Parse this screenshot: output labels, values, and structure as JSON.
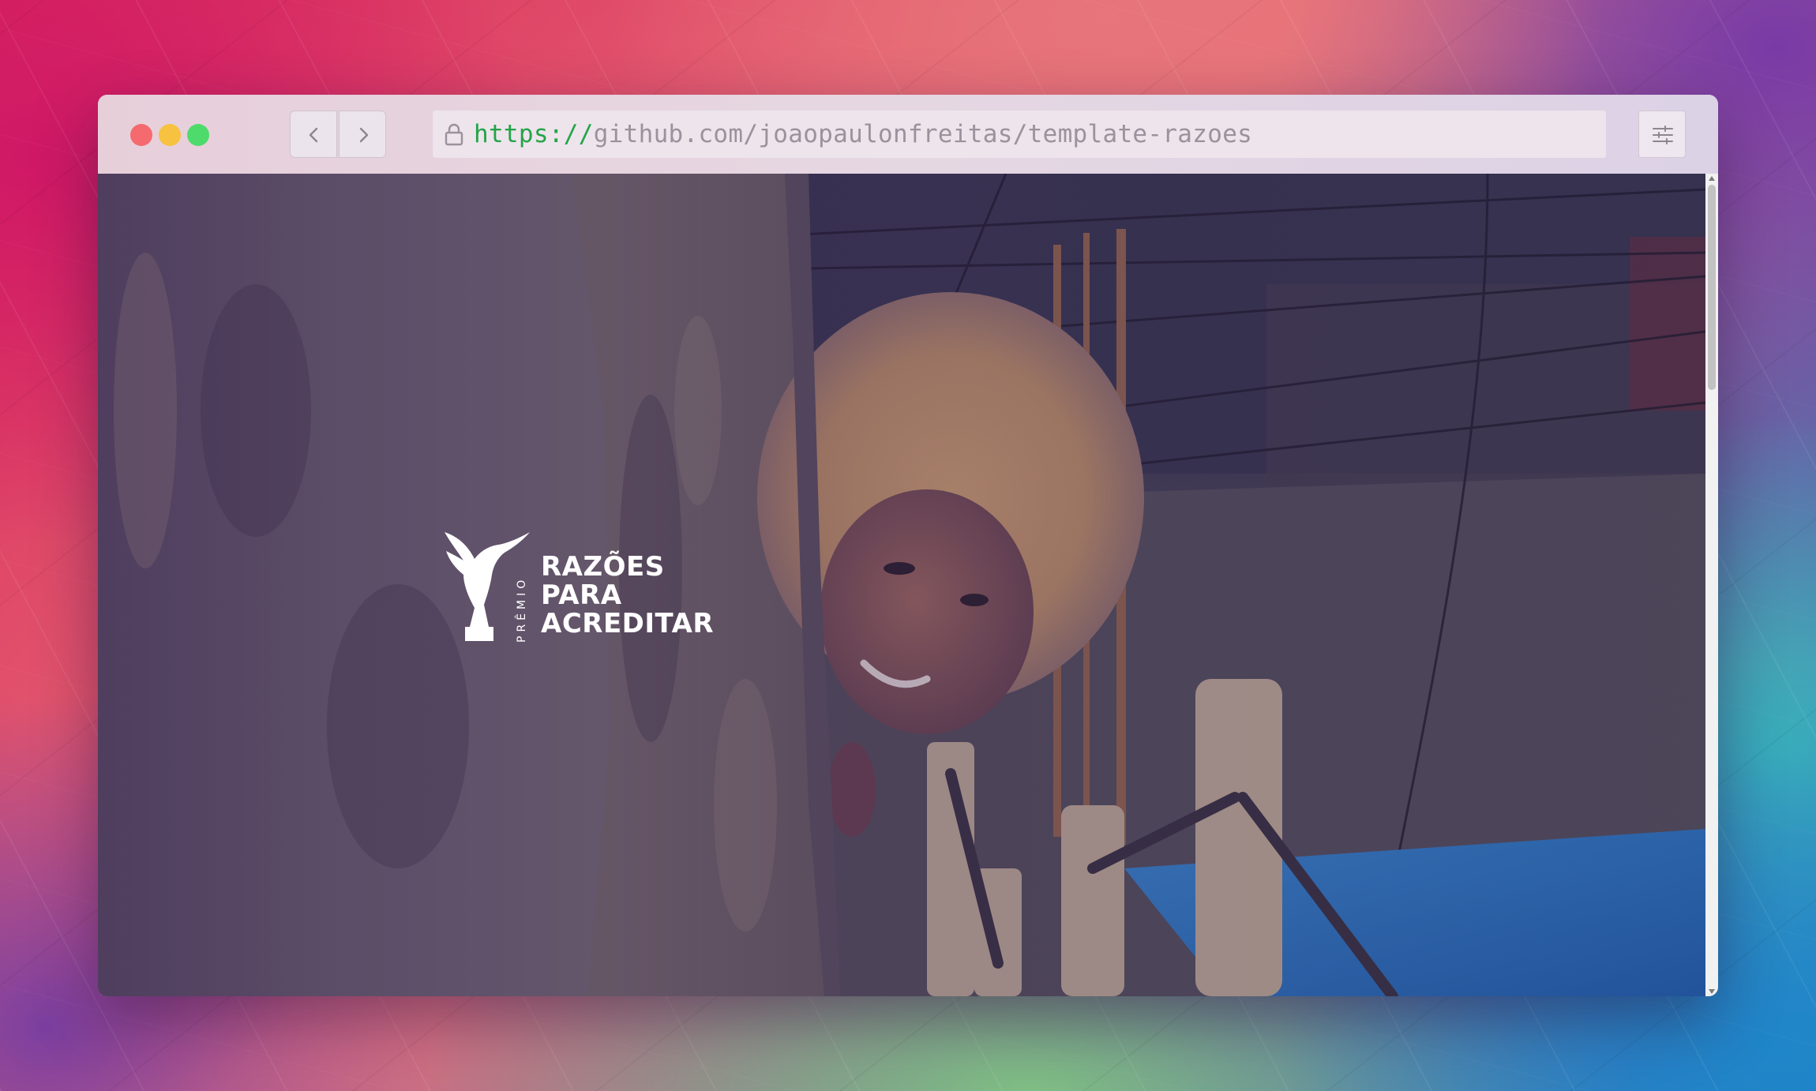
{
  "window": {
    "controls": [
      "close",
      "minimize",
      "zoom"
    ],
    "accent_colors": {
      "close": "#f46a6f",
      "minimize": "#f7c23f",
      "zoom": "#4fdb6c"
    }
  },
  "toolbar": {
    "back_icon": "chevron-left-icon",
    "forward_icon": "chevron-right-icon",
    "menu_icon": "sliders-icon"
  },
  "address_bar": {
    "lock_icon": "lock-icon",
    "scheme": "https://",
    "path": "github.com/joaopaulonfreitas/template-razoes",
    "scheme_color": "#23a447"
  },
  "hero": {
    "logo": {
      "premio": "PRÊMIO",
      "line1": "RAZÕES",
      "line2": "PARA",
      "line3": "ACREDITAR"
    }
  }
}
